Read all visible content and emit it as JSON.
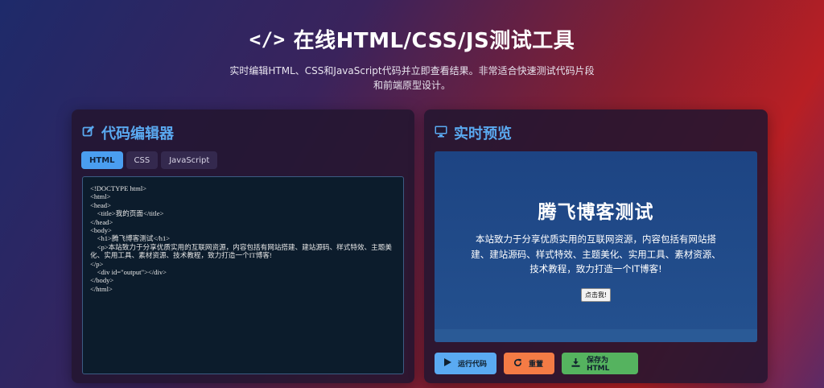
{
  "header": {
    "title": "在线HTML/CSS/JS测试工具",
    "code_icon": "</>",
    "subtitle": "实时编辑HTML、CSS和JavaScript代码并立即查看结果。非常适合快速测试代码片段和前端原型设计。"
  },
  "editor": {
    "title": "代码编辑器",
    "icon": "edit-icon",
    "tabs": [
      {
        "label": "HTML",
        "active": true
      },
      {
        "label": "CSS",
        "active": false
      },
      {
        "label": "JavaScript",
        "active": false
      }
    ],
    "code_lines": [
      "<!DOCTYPE html>",
      "<html>",
      "<head>",
      "    <title>我的页面</title>",
      "</head>",
      "<body>",
      "    <h1>腾飞博客测试</h1>",
      "    <p>本站致力于分享优质实用的互联网资源，内容包括有网站搭建、建站源码、样式特效、主题美化、实用工具、素材资源、技术教程，致力打造一个IT博客!",
      "</p>",
      "    <div id=\"output\"></div>",
      "</body>",
      "</html>"
    ]
  },
  "preview": {
    "title": "实时预览",
    "icon": "monitor-icon",
    "heading": "腾飞博客测试",
    "paragraph": "本站致力于分享优质实用的互联网资源，内容包括有网站搭建、建站源码、样式特效、主题美化、实用工具、素材资源、技术教程，致力打造一个IT博客!",
    "button_label": "点击我!"
  },
  "actions": {
    "run_label": "运行代码",
    "reset_label": "重置",
    "save_label": "保存为HTML",
    "run_icon": "play-icon",
    "reset_icon": "refresh-icon",
    "save_icon": "download-icon"
  },
  "colors": {
    "accent": "#5aa9f0",
    "run": "#5aaaf2",
    "reset": "#f47b45",
    "save": "#55b35f"
  }
}
